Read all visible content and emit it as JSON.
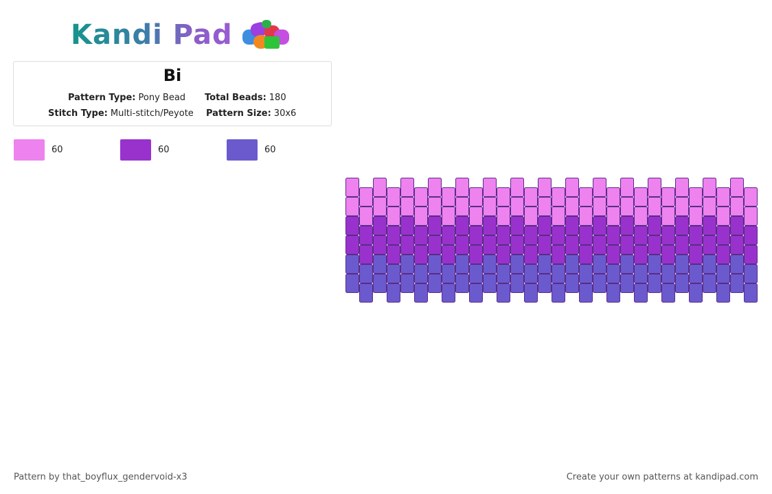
{
  "brand": {
    "name": "Kandi Pad",
    "logo_icon": "beads-cluster-icon"
  },
  "pattern": {
    "title": "Bi",
    "pattern_type_label": "Pattern Type:",
    "pattern_type": "Pony Bead",
    "total_beads_label": "Total Beads:",
    "total_beads": "180",
    "stitch_type_label": "Stitch Type:",
    "stitch_type": "Multi-stitch/Peyote",
    "pattern_size_label": "Pattern Size:",
    "pattern_size": "30x6"
  },
  "colors": [
    {
      "hex": "#ee82ee",
      "count": "60"
    },
    {
      "hex": "#9932cc",
      "count": "60"
    },
    {
      "hex": "#6a5acd",
      "count": "60"
    }
  ],
  "grid": {
    "columns": 30,
    "rows": 6,
    "row_colors": [
      0,
      0,
      1,
      1,
      2,
      2
    ],
    "bead_stroke": "#5a2a8a"
  },
  "footer": {
    "author": "Pattern by that_boyflux_gendervoid-x3",
    "cta": "Create your own patterns at kandipad.com"
  }
}
